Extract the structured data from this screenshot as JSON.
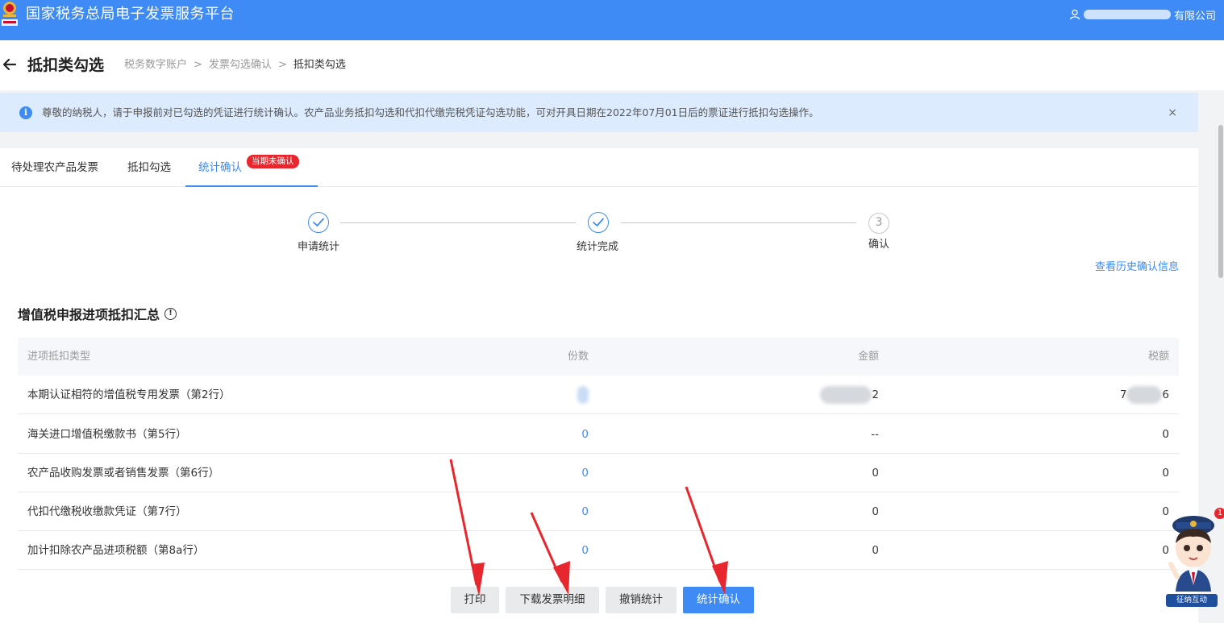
{
  "app": {
    "title": "国家税务总局电子发票服务平台",
    "user_suffix": "有限公司"
  },
  "header": {
    "title": "抵扣类勾选",
    "breadcrumb": [
      "税务数字账户",
      "发票勾选确认",
      "抵扣类勾选"
    ],
    "separator": ">"
  },
  "notice": {
    "icon": "i",
    "text": "尊敬的纳税人，请于申报前对已勾选的凭证进行统计确认。农产品业务抵扣勾选和代扣代缴完税凭证勾选功能，可对开具日期在2022年07月01日后的票证进行抵扣勾选操作。",
    "close": "×"
  },
  "tabs": [
    {
      "label": "待处理农产品发票"
    },
    {
      "label": "抵扣勾选"
    },
    {
      "label": "统计确认",
      "badge": "当期未确认"
    }
  ],
  "steps": [
    {
      "label": "申请统计",
      "status": "done"
    },
    {
      "label": "统计完成",
      "status": "done"
    },
    {
      "label": "确认",
      "status": "pending",
      "number": "3"
    }
  ],
  "history_link": "查看历史确认信息",
  "summary": {
    "title": "增值税申报进项抵扣汇总",
    "info_icon": "!",
    "columns": [
      "进项抵扣类型",
      "份数",
      "金额",
      "税额"
    ],
    "rows": [
      {
        "type": "本期认证相符的增值税专用发票（第2行）",
        "count": "",
        "amount": "2",
        "tax_prefix": "7",
        "tax_suffix": "6"
      },
      {
        "type": "海关进口增值税缴款书（第5行）",
        "count": "0",
        "amount": "--",
        "tax": "0"
      },
      {
        "type": "农产品收购发票或者销售发票（第6行）",
        "count": "0",
        "amount": "0",
        "tax": "0"
      },
      {
        "type": "代扣代缴税收缴款凭证（第7行）",
        "count": "0",
        "amount": "0",
        "tax": "0"
      },
      {
        "type": "加计扣除农产品进项税额（第8a行）",
        "count": "0",
        "amount": "0",
        "tax": "0"
      }
    ]
  },
  "buttons": {
    "print": "打印",
    "download": "下载发票明细",
    "revoke": "撤销统计",
    "confirm": "统计确认"
  },
  "assistant": {
    "badge": "1",
    "label": "征纳互动"
  },
  "colors": {
    "brand": "#3e8bf5",
    "badge": "#e8262d",
    "arrow": "#e8262d"
  }
}
